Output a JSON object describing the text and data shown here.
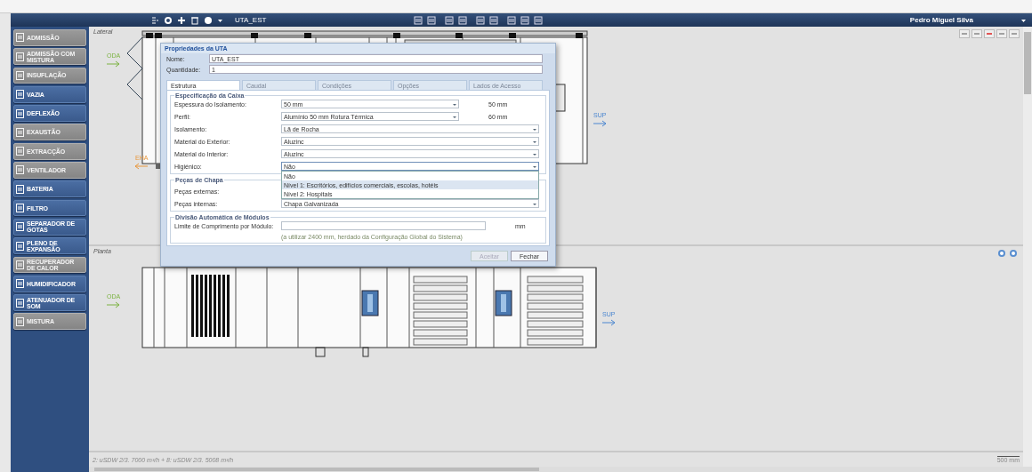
{
  "toolbar": {
    "document": "UTA_EST",
    "user": "Pedro Miguel Silva"
  },
  "sidebar": {
    "items": [
      {
        "label": "ADMISSÃO",
        "disabled": true
      },
      {
        "label": "ADMISSÃO COM MISTURA",
        "disabled": true
      },
      {
        "label": "INSUFLAÇÃO",
        "disabled": true
      },
      {
        "label": "VAZIA",
        "disabled": false
      },
      {
        "label": "DEFLEXÃO",
        "disabled": false
      },
      {
        "label": "EXAUSTÃO",
        "disabled": true
      },
      {
        "label": "EXTRACÇÃO",
        "disabled": true
      },
      {
        "label": "VENTILADOR",
        "disabled": true
      },
      {
        "label": "BATERIA",
        "disabled": false
      },
      {
        "label": "FILTRO",
        "disabled": false
      },
      {
        "label": "SEPARADOR DE GOTAS",
        "disabled": false
      },
      {
        "label": "PLENO DE EXPANSÃO",
        "disabled": false
      },
      {
        "label": "RECUPERADOR DE CALOR",
        "disabled": true
      },
      {
        "label": "HUMIDIFICADOR",
        "disabled": false
      },
      {
        "label": "ATENUADOR DE SOM",
        "disabled": false
      },
      {
        "label": "MISTURA",
        "disabled": true
      }
    ]
  },
  "views": [
    {
      "title": "Lateral",
      "kind": "side",
      "flows": [
        {
          "label": "ODA",
          "kind": "intake"
        },
        {
          "label": "EHA",
          "kind": "exhaust"
        },
        {
          "label": "SUP",
          "kind": "supply"
        }
      ]
    },
    {
      "title": "Planta",
      "kind": "plan",
      "flows": [
        {
          "label": "ODA",
          "kind": "intake"
        },
        {
          "label": "SUP",
          "kind": "supply"
        }
      ]
    }
  ],
  "dialog": {
    "title": "Propriedades da UTA",
    "fields": [
      {
        "label": "Nome:",
        "value": "UTA_EST"
      },
      {
        "label": "Quantidade:",
        "value": "1"
      }
    ],
    "tabs": [
      {
        "label": "Estrutura",
        "selected": true
      },
      {
        "label": "Caudal",
        "selected": false
      },
      {
        "label": "Condições",
        "selected": false
      },
      {
        "label": "Opções",
        "selected": false
      },
      {
        "label": "Lados de Acesso",
        "selected": false
      }
    ],
    "groups": [
      {
        "title": "Especificação da Caixa",
        "rows": [
          {
            "kind": "select",
            "label": "Espessura do Isolamento:",
            "value": "50 mm",
            "unit": "50 mm"
          },
          {
            "kind": "select",
            "label": "Perfil:",
            "value": "Alumínio 50 mm Rotura Térmica",
            "unit": "60 mm"
          },
          {
            "kind": "select",
            "label": "Isolamento:",
            "value": "Lã de Rocha"
          },
          {
            "kind": "select",
            "label": "Material do Exterior:",
            "value": "Aluzinc"
          },
          {
            "kind": "select",
            "label": "Material do Interior:",
            "value": "Aluzinc"
          },
          {
            "kind": "select",
            "label": "Higiénico:",
            "value": "Não",
            "open": true
          }
        ]
      },
      {
        "title": "Peças de Chapa",
        "rows": [
          {
            "kind": "select",
            "label": "Peças externas:"
          },
          {
            "kind": "select",
            "label": "Peças internas:",
            "value": "Chapa Galvanizada"
          }
        ]
      },
      {
        "title": "Divisão Automática de Módulos",
        "rows": [
          {
            "kind": "input",
            "label": "Limite de Comprimento por Módulo:",
            "unit": "mm",
            "hint": "(a utilizar 2400 mm, herdado da Configuração Global do Sistema)"
          }
        ]
      }
    ],
    "dropdown": [
      {
        "label": "Não",
        "selected": false
      },
      {
        "label": "Nível 1: Escritórios, edifícios comerciais, escolas, hotéis",
        "selected": true
      },
      {
        "label": "Nível 2: Hospitais",
        "selected": false
      }
    ],
    "buttons": [
      {
        "label": "Aceitar",
        "disabled": true
      },
      {
        "label": "Fechar",
        "disabled": false
      }
    ]
  },
  "status_text": "2: uSDW 2/3. 7000 m³/h + 8: uSDW 2/3. 5008 m³/h",
  "scale": "500 mm"
}
